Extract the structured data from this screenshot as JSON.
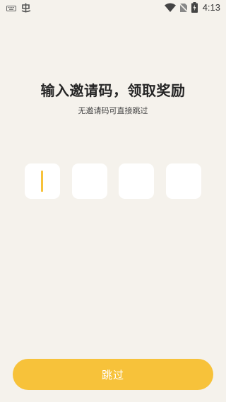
{
  "status_bar": {
    "time": "4:13",
    "left_icons": [
      "keyboard-icon",
      "app-notification-icon"
    ],
    "right_icons": [
      "wifi-icon",
      "no-sim-icon",
      "battery-charging-icon"
    ]
  },
  "main": {
    "title": "输入邀请码，领取奖励",
    "subtitle": "无邀请码可直接跳过",
    "code_boxes": [
      "",
      "",
      "",
      ""
    ],
    "active_box_index": 0
  },
  "footer": {
    "skip_label": "跳过"
  },
  "colors": {
    "background": "#f5f2ec",
    "accent": "#f7c23a",
    "box": "#ffffff"
  }
}
